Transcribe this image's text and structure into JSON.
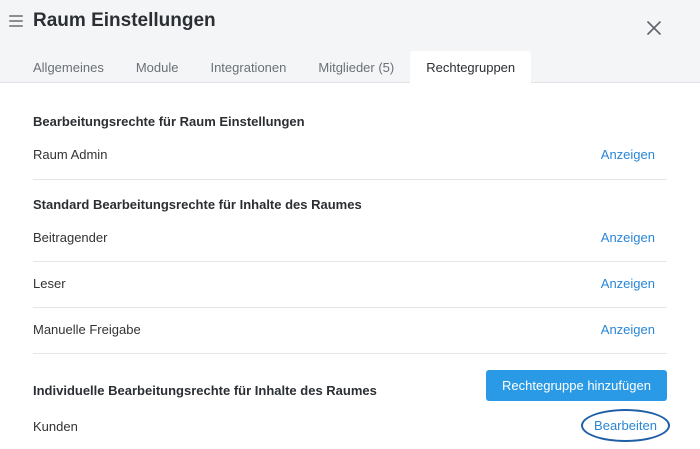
{
  "header": {
    "title": "Raum Einstellungen",
    "menu_icon": "hamburger-menu-icon",
    "close_icon": "close-icon"
  },
  "tabs": [
    {
      "label": "Allgemeines",
      "active": false
    },
    {
      "label": "Module",
      "active": false
    },
    {
      "label": "Integrationen",
      "active": false
    },
    {
      "label": "Mitglieder (5)",
      "active": false
    },
    {
      "label": "Rechtegruppen",
      "active": true
    }
  ],
  "sections": {
    "room_settings": {
      "title": "Bearbeitungsrechte für Raum Einstellungen",
      "rows": [
        {
          "label": "Raum Admin",
          "action": "Anzeigen"
        }
      ]
    },
    "standard": {
      "title": "Standard Bearbeitungsrechte für Inhalte des Raumes",
      "rows": [
        {
          "label": "Beitragender",
          "action": "Anzeigen"
        },
        {
          "label": "Leser",
          "action": "Anzeigen"
        },
        {
          "label": "Manuelle Freigabe",
          "action": "Anzeigen"
        }
      ]
    },
    "individual": {
      "title": "Individuelle Bearbeitungsrechte für Inhalte des Raumes",
      "add_button": "Rechtegruppe hinzufügen",
      "rows": [
        {
          "label": "Kunden",
          "action": "Bearbeiten"
        }
      ]
    }
  },
  "colors": {
    "accent": "#2a9ae6",
    "link": "#2a86d6",
    "highlight_ring": "#1f5fa8",
    "header_bg": "#f4f5f6"
  }
}
